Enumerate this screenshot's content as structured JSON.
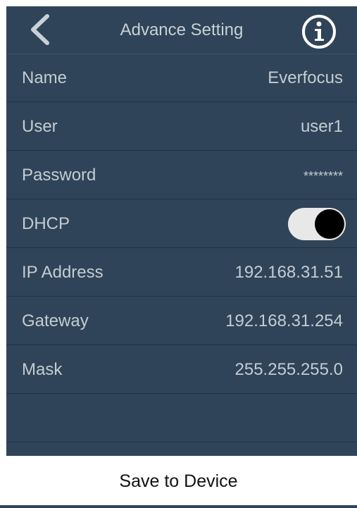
{
  "header": {
    "title": "Advance Setting",
    "back_icon": "chevron-left-icon",
    "info_icon": "info-circle-icon"
  },
  "settings": {
    "name": {
      "label": "Name",
      "value": "Everfocus"
    },
    "user": {
      "label": "User",
      "value": "user1"
    },
    "password": {
      "label": "Password",
      "value": "********"
    },
    "dhcp": {
      "label": "DHCP",
      "enabled": true
    },
    "ip_address": {
      "label": "IP Address",
      "value": "192.168.31.51"
    },
    "gateway": {
      "label": "Gateway",
      "value": "192.168.31.254"
    },
    "mask": {
      "label": "Mask",
      "value": "255.255.255.0"
    }
  },
  "footer": {
    "save_label": "Save to Device"
  },
  "colors": {
    "background": "#2f4458",
    "text": "#c4ccd4",
    "separator": "#22323f",
    "toggle_track": "#e8e8e8",
    "toggle_knob": "#000000"
  }
}
